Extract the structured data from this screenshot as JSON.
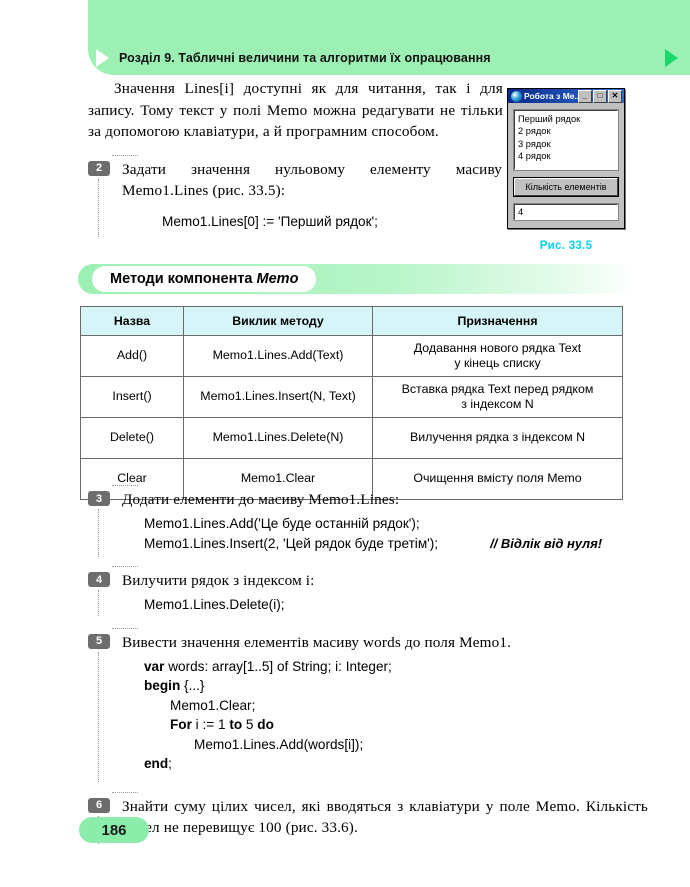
{
  "header": {
    "title": "Розділ 9.  Табличні величини та алгоритми їх опрацювання"
  },
  "intro": {
    "paragraph": "Значення Lines[i] доступні як для читання, так і для запису. Тому текст у полі Memo можна редагувати не тільки за допомогою клавіатури, а й програмним способом."
  },
  "items": [
    {
      "number": "2",
      "text": "Задати значення нульовому елементу масиву Memo1.Lines (рис. 33.5):",
      "code": [
        "Memo1.Lines[0] := 'Перший рядок';"
      ]
    },
    {
      "number": "3",
      "text": "Додати елементи до масиву Memo1.Lines:",
      "code": [
        "Memo1.Lines.Add('Це буде останній рядок');",
        "Memo1.Lines.Insert(2, 'Цей рядок буде третім');"
      ],
      "comment": "// Відлік від нуля!"
    },
    {
      "number": "4",
      "text": "Вилучити рядок з індексом i:",
      "code": [
        "Memo1.Lines.Delete(i);"
      ]
    },
    {
      "number": "5",
      "text": "Вивести значення елементів масиву words до поля Memo1.",
      "code_lines": [
        {
          "kw": "var",
          "rest": " words: array[1..5] of String; i: Integer;",
          "indent": 2
        },
        {
          "kw": "begin",
          "rest": " {...}",
          "indent": 2
        },
        {
          "kw": "",
          "rest": "Memo1.Clear;",
          "indent": 3
        },
        {
          "kw": "For",
          "rest": " i := 1 ",
          "kw2": "to",
          "rest2": " 5 ",
          "kw3": "do",
          "rest3": "",
          "indent": 3
        },
        {
          "kw": "",
          "rest": "Memo1.Lines.Add(words[i]);",
          "indent": 4
        },
        {
          "kw": "end",
          "rest": ";",
          "indent": 2
        }
      ]
    },
    {
      "number": "6",
      "text": "Знайти суму цілих чисел, які вводяться з клавіатури у поле Memo. Кількість чисел не перевищує 100 (рис. 33.6)."
    }
  ],
  "figure": {
    "window_title": "Робота з Ме...",
    "minimize_label": "_",
    "maximize_label": "□",
    "close_label": "✕",
    "memo_lines": [
      "Перший рядок",
      "2 рядок",
      "3 рядок",
      "4 рядок"
    ],
    "button_label": "Кількість елементів",
    "input_value": "4",
    "caption": "Рис. 33.5"
  },
  "section": {
    "heading_main": "Методи компонента ",
    "heading_italic": "Memo"
  },
  "table": {
    "headers": [
      "Назва",
      "Виклик методу",
      "Призначення"
    ],
    "rows": [
      [
        "Add()",
        "Memo1.Lines.Add(Text)",
        "Додавання нового рядка Text\nу кінець списку"
      ],
      [
        "Insert()",
        "Memo1.Lines.Insert(N, Text)",
        "Вставка рядка Text перед рядком\nз індексом N"
      ],
      [
        "Delete()",
        "Memo1.Lines.Delete(N)",
        "Вилучення рядка з індексом N"
      ],
      [
        "Clear",
        "Memo1.Clear",
        "Очищення вмісту поля Memo"
      ]
    ]
  },
  "footer": {
    "page_number": "186"
  },
  "colors": {
    "banner_green": "#9cf0b4",
    "page_badge_green": "#8cedaa",
    "table_header_cyan": "#d6f5f8",
    "caption_cyan": "#00d2f0",
    "item_badge_gray": "#6d6d6d",
    "title_bar_blue": "#0a2a8c"
  }
}
